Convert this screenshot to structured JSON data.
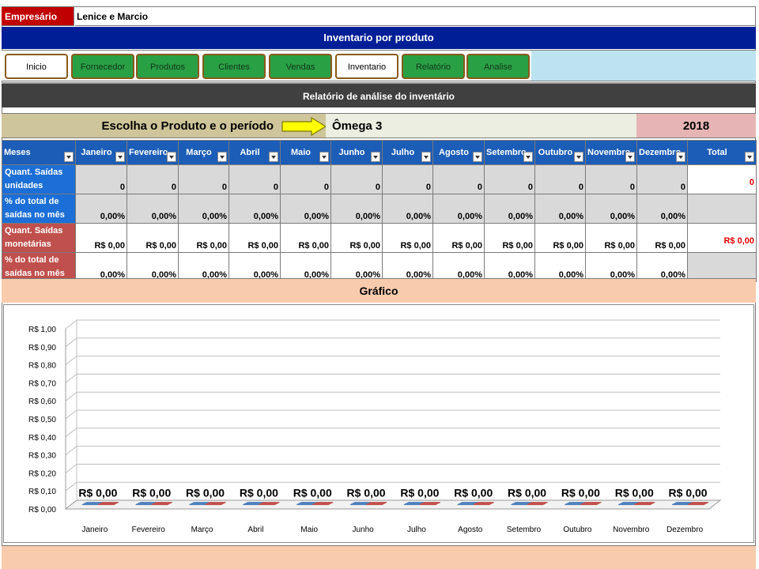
{
  "header": {
    "empresario_label": "Empresário",
    "empresario_value": "Lenice e Marcio",
    "title": "Inventario por produto"
  },
  "nav": [
    {
      "label": "Inicio",
      "style": "white"
    },
    {
      "label": "Fornecedor",
      "style": "green"
    },
    {
      "label": "Produtos",
      "style": "green"
    },
    {
      "label": "Clientes",
      "style": "green"
    },
    {
      "label": "Vendas",
      "style": "green"
    },
    {
      "label": "Inventario",
      "style": "white"
    },
    {
      "label": "Relatório",
      "style": "green"
    },
    {
      "label": "Analise",
      "style": "green"
    }
  ],
  "report_title": "Relatório de análise do inventário",
  "selector": {
    "label": "Escolha o Produto e o período",
    "product": "Ômega 3",
    "year": "2018"
  },
  "table": {
    "first_header": "Meses",
    "months": [
      "Janeiro",
      "Fevereiro",
      "Março",
      "Abril",
      "Maio",
      "Junho",
      "Julho",
      "Agosto",
      "Setembro",
      "Outubro",
      "Novembro",
      "Dezembro"
    ],
    "total_header": "Total",
    "rows": {
      "qty": {
        "label": "Quant. Saídas unidades",
        "values": [
          "0",
          "0",
          "0",
          "0",
          "0",
          "0",
          "0",
          "0",
          "0",
          "0",
          "0",
          "0"
        ],
        "total": "0"
      },
      "qty_pct": {
        "label": "% do total de saídas no mês",
        "values": [
          "0,00%",
          "0,00%",
          "0,00%",
          "0,00%",
          "0,00%",
          "0,00%",
          "0,00%",
          "0,00%",
          "0,00%",
          "0,00%",
          "0,00%",
          "0,00%"
        ],
        "total": ""
      },
      "money": {
        "label": "Quant. Saídas monetárias",
        "values": [
          "R$ 0,00",
          "R$ 0,00",
          "R$ 0,00",
          "R$ 0,00",
          "R$ 0,00",
          "R$ 0,00",
          "R$ 0,00",
          "R$ 0,00",
          "R$ 0,00",
          "R$ 0,00",
          "R$ 0,00",
          "R$ 0,00"
        ],
        "total": "R$ 0,00"
      },
      "money_pct": {
        "label": "% do total de saídas no mês",
        "values": [
          "0,00%",
          "0,00%",
          "0,00%",
          "0,00%",
          "0,00%",
          "0,00%",
          "0,00%",
          "0,00%",
          "0,00%",
          "0,00%",
          "0,00%",
          "0,00%"
        ],
        "total": ""
      }
    }
  },
  "chart_section_title": "Gráfico",
  "chart_data": {
    "type": "bar",
    "categories": [
      "Janeiro",
      "Fevereiro",
      "Março",
      "Abril",
      "Maio",
      "Junho",
      "Julho",
      "Agosto",
      "Setembro",
      "Outubro",
      "Novembro",
      "Dezembro"
    ],
    "series": [
      {
        "values": [
          0,
          0,
          0,
          0,
          0,
          0,
          0,
          0,
          0,
          0,
          0,
          0
        ],
        "color": "#4f81bd"
      },
      {
        "values": [
          0,
          0,
          0,
          0,
          0,
          0,
          0,
          0,
          0,
          0,
          0,
          0
        ],
        "color": "#c0504d"
      }
    ],
    "data_labels": [
      "R$ 0,00",
      "R$ 0,00",
      "R$ 0,00",
      "R$ 0,00",
      "R$ 0,00",
      "R$ 0,00",
      "R$ 0,00",
      "R$ 0,00",
      "R$ 0,00",
      "R$ 0,00",
      "R$ 0,00",
      "R$ 0,00"
    ],
    "y_ticks": [
      "R$ 0,00",
      "R$ 0,10",
      "R$ 0,20",
      "R$ 0,30",
      "R$ 0,40",
      "R$ 0,50",
      "R$ 0,60",
      "R$ 0,70",
      "R$ 0,80",
      "R$ 0,90",
      "R$ 1,00"
    ],
    "ylim": [
      0,
      1
    ],
    "grid": true,
    "three_d": true
  }
}
